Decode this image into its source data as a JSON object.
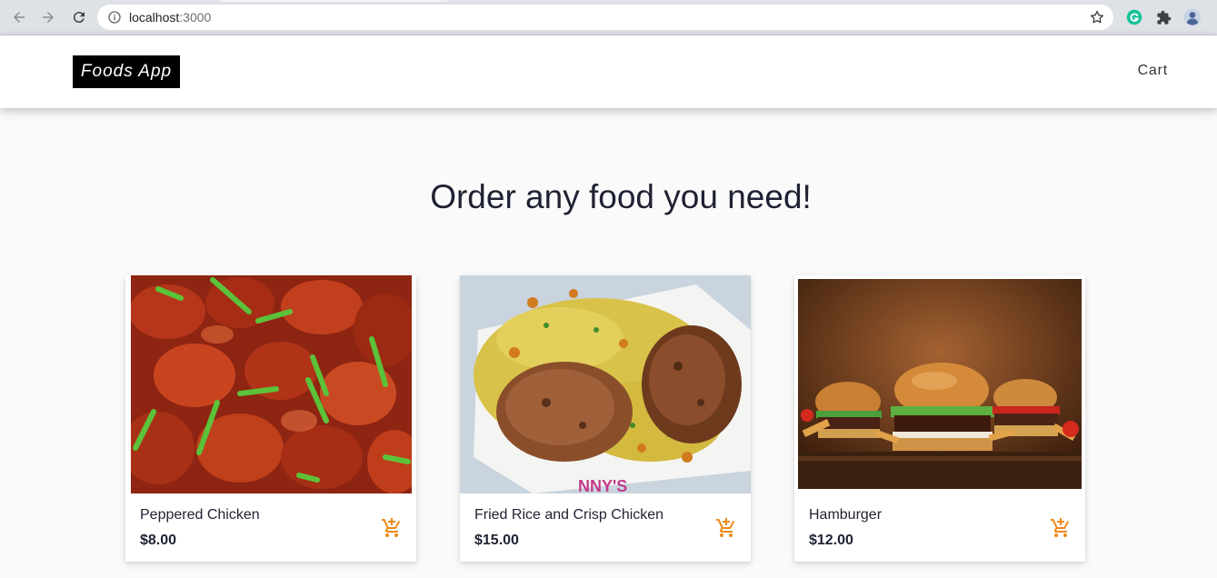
{
  "browser": {
    "url_host": "localhost",
    "url_port": ":3000"
  },
  "navbar": {
    "brand": "Foods App",
    "cart_label": "Cart"
  },
  "main": {
    "headline": "Order any food you need!"
  },
  "foods": [
    {
      "name": "Peppered Chicken",
      "price": "$8.00"
    },
    {
      "name": "Fried Rice and Crisp Chicken",
      "price": "$15.00"
    },
    {
      "name": "Hamburger",
      "price": "$12.00"
    }
  ],
  "colors": {
    "accent": "#ef8a17",
    "brand_bg": "#000000",
    "text": "#1f2233"
  }
}
